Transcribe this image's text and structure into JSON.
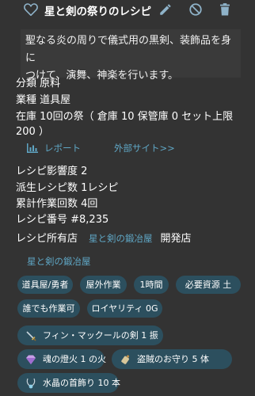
{
  "header": {
    "title": "星と剣の祭りのレシピ"
  },
  "description": {
    "line1": "聖なる炎の周りで儀式用の黒剣、装飾品を身に",
    "line2": "つけて、演舞、神楽を行います。"
  },
  "info": {
    "category": "分類 原料",
    "industry": "業種 道具屋",
    "stock_line1": "在庫 10回の祭（ 倉庫 10 保管庫 0 セット上限",
    "stock_line2": "200 ）"
  },
  "links": {
    "report": "レポート",
    "external": "外部サイト>>"
  },
  "stats": {
    "influence": "レシピ影響度 2",
    "derived": "派生レシピ数 1レシピ",
    "cumulative": "累計作業回数 4回",
    "number": "レシピ番号 #8,235"
  },
  "owner": {
    "label": "レシピ所有店",
    "shop_link": "星と剣の鍛冶屋",
    "status": "開発店"
  },
  "shop_name": "星と剣の鍛冶屋",
  "tags": [
    "道具屋/勇者",
    "屋外作業",
    "1時間",
    "必要資源 土",
    "誰でも作業可",
    "ロイヤリティ 0G"
  ],
  "materials": [
    "フィン・マックールの剣 1 振",
    "魂の燈火 1 の火",
    "盗賊のお守り 5 体",
    "水晶の首飾り 10 本"
  ],
  "colors": {
    "background": "#333333",
    "accent": "#5fa6c4",
    "chip": "#2c4f5e",
    "icon": "#8fb3c9"
  }
}
